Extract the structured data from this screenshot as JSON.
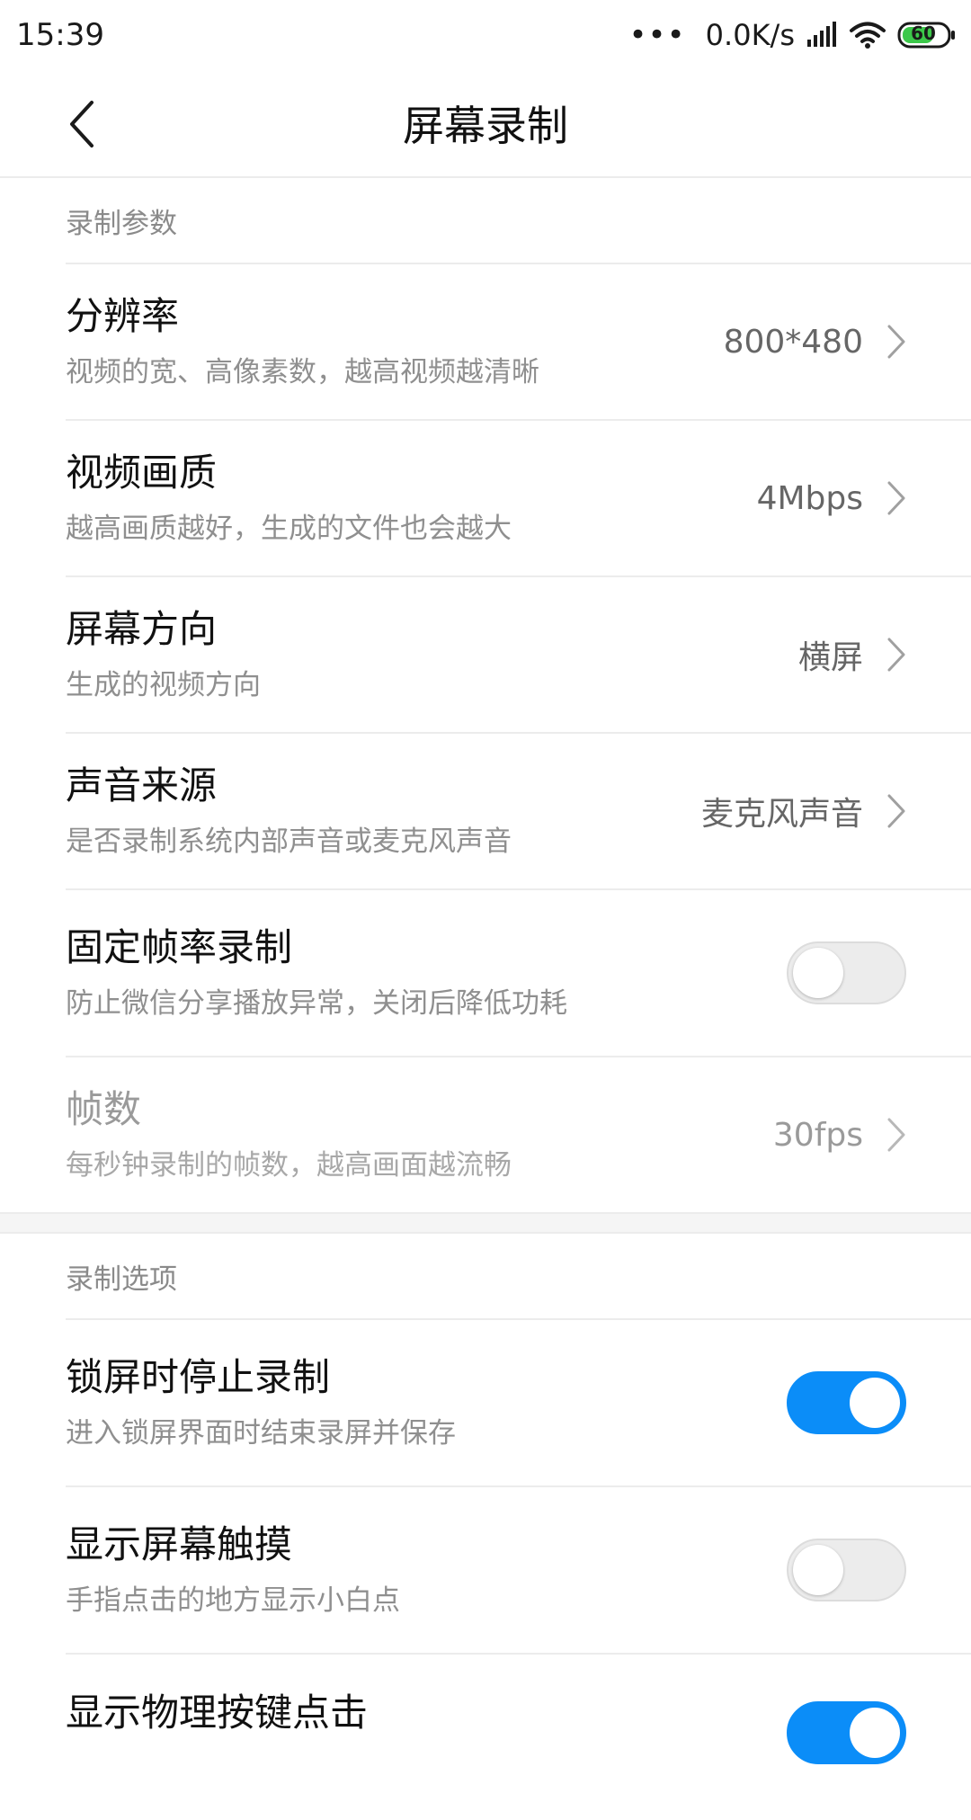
{
  "status_bar": {
    "time": "15:39",
    "dots": "•••",
    "network_speed": "0.0K/s",
    "battery": "60",
    "icons": [
      "signal-icon",
      "wifi-icon",
      "battery-icon"
    ]
  },
  "header": {
    "title": "屏幕录制",
    "back_icon": "chevron-left-icon"
  },
  "section_params": {
    "label": "录制参数",
    "resolution": {
      "title": "分辨率",
      "subtitle": "视频的宽、高像素数，越高视频越清晰",
      "value": "800*480"
    },
    "quality": {
      "title": "视频画质",
      "subtitle": "越高画质越好，生成的文件也会越大",
      "value": "4Mbps"
    },
    "orientation": {
      "title": "屏幕方向",
      "subtitle": "生成的视频方向",
      "value": "横屏"
    },
    "audio_source": {
      "title": "声音来源",
      "subtitle": "是否录制系统内部声音或麦克风声音",
      "value": "麦克风声音"
    },
    "fixed_fps": {
      "title": "固定帧率录制",
      "subtitle": "防止微信分享播放异常，关闭后降低功耗",
      "enabled": false
    },
    "frame_rate": {
      "title": "帧数",
      "subtitle": "每秒钟录制的帧数，越高画面越流畅",
      "value": "30fps",
      "disabled": true
    }
  },
  "section_options": {
    "label": "录制选项",
    "stop_on_lock": {
      "title": "锁屏时停止录制",
      "subtitle": "进入锁屏界面时结束录屏并保存",
      "enabled": true
    },
    "show_touches": {
      "title": "显示屏幕触摸",
      "subtitle": "手指点击的地方显示小白点",
      "enabled": false
    },
    "show_key_press": {
      "title": "显示物理按键点击",
      "enabled": true
    }
  },
  "colors": {
    "accent": "#0b8df8",
    "divider": "#ececec",
    "battery_fill": "#3cc84a"
  }
}
